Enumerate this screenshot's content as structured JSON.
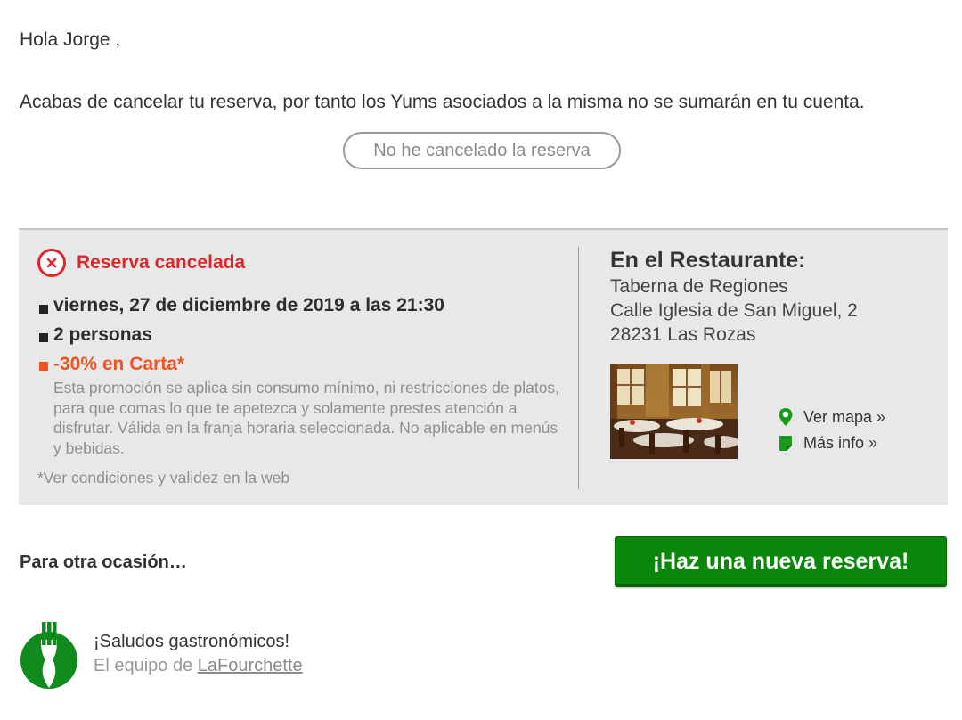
{
  "email": {
    "greeting": "Hola Jorge ,",
    "intro": "Acabas de cancelar tu reserva, por tanto los Yums asociados a la misma no se sumarán en tu cuenta.",
    "not_cancelled_button": "No he cancelado la reserva"
  },
  "booking": {
    "status": "Reserva cancelada",
    "date": "viernes, 27 de diciembre de 2019 a las 21:30",
    "people": "2 personas",
    "promo": "-30% en Carta*",
    "promo_description": "Esta promoción se aplica sin consumo mínimo, ni restricciones de platos, para que comas lo que te apetezca y solamente prestes atención a disfrutar. Válida en la franja horaria seleccionada. No aplicable en menús y bebidas.",
    "conditions": "*Ver condiciones y validez en la web"
  },
  "restaurant": {
    "heading": "En el Restaurante:",
    "name": "Taberna de Regiones",
    "street": "Calle Iglesia de San Miguel, 2",
    "city": "28231 Las Rozas",
    "map_link": "Ver mapa »",
    "info_link": "Más info »"
  },
  "footer": {
    "another_time": "Para otra ocasión…",
    "new_booking_button": "¡Haz una nueva reserva!",
    "farewell": "¡Saludos gastronómicos!",
    "team_prefix": "El equipo de ",
    "brand": "LaFourchette"
  },
  "colors": {
    "cancel_red": "#e0262b",
    "promo_orange": "#f0531f",
    "brand_green": "#0a870a"
  },
  "icons": [
    "cancel-x-icon",
    "map-pin-icon",
    "info-document-icon",
    "lafourchette-fork-logo"
  ]
}
